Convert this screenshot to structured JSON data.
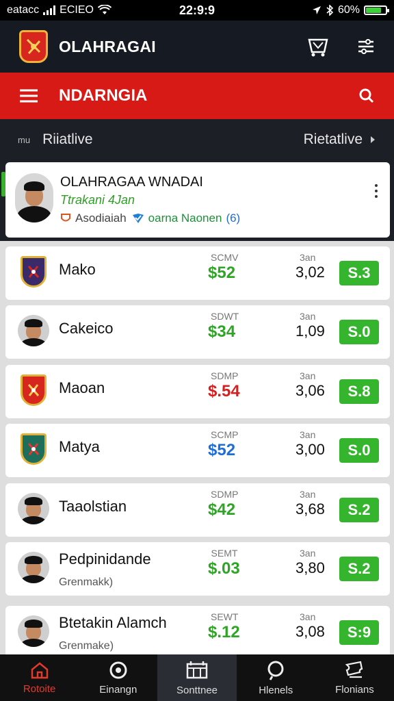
{
  "status_bar": {
    "carrier": "eatacc",
    "network": "ECIEO",
    "time": "22:9:9",
    "battery_pct": "60%",
    "battery_level": 0.8
  },
  "header": {
    "title": "OLAHRAGAI",
    "cart_icon": "basket-icon",
    "filter_icon": "sliders-icon"
  },
  "section_bar": {
    "title": "NDARNGIA",
    "menu_icon": "hamburger-icon",
    "search_icon": "search-icon"
  },
  "filter_row": {
    "left_label": "Riiatlive",
    "left_prefix": "mu",
    "right_label": "Rietatlive"
  },
  "featured": {
    "name": "OLAHRAGAA WNADAI",
    "subtitle": "Ttrakani 4Jan",
    "tag1": "Asodiaiah",
    "tag2": "oarna Naonen",
    "tag2_suffix": "(6)"
  },
  "rows": [
    {
      "name": "Mako",
      "sub": "",
      "label": "SCMV",
      "price": "$52",
      "price_color": "#2fa427",
      "cap": "3an",
      "num": "3,02",
      "score": "S.3",
      "thumb": "crest"
    },
    {
      "name": "Cakeico",
      "sub": "",
      "label": "SDWT",
      "price": "$34",
      "price_color": "#2fa427",
      "cap": "3an",
      "num": "1,09",
      "score": "S.0",
      "thumb": "player"
    },
    {
      "name": "Maoan",
      "sub": "",
      "label": "SDMP",
      "price": "$.54",
      "price_color": "#d71f1f",
      "cap": "3an",
      "num": "3,06",
      "score": "S.8",
      "thumb": "crest-red"
    },
    {
      "name": "Matya",
      "sub": "",
      "label": "SCMP",
      "price": "$52",
      "price_color": "#1e6ed8",
      "cap": "3an",
      "num": "3,00",
      "score": "S.0",
      "thumb": "crest-green"
    },
    {
      "name": "Taaolstian",
      "sub": "",
      "label": "SDMP",
      "price": "$42",
      "price_color": "#2fa427",
      "cap": "3an",
      "num": "3,68",
      "score": "S.2",
      "thumb": "player"
    },
    {
      "name": "Pedpinidande",
      "sub": "Grenmakk)",
      "label": "SEMT",
      "price": "$.03",
      "price_color": "#2fa427",
      "cap": "3an",
      "num": "3,80",
      "score": "S.2",
      "thumb": "player"
    },
    {
      "name": "Btetakin Alamch",
      "sub": "Grenmake)",
      "label": "SEWT",
      "price": "$.12",
      "price_color": "#2fa427",
      "cap": "3an",
      "num": "3,08",
      "score": "S:9",
      "thumb": "player"
    }
  ],
  "bottom_nav": [
    {
      "label": "Rotoite",
      "icon": "home-icon"
    },
    {
      "label": "Einangn",
      "icon": "target-icon"
    },
    {
      "label": "Sonttnee",
      "icon": "stats-icon"
    },
    {
      "label": "Hlenels",
      "icon": "search-icon"
    },
    {
      "label": "Flonians",
      "icon": "ticket-icon"
    }
  ],
  "colors": {
    "brand_red": "#d81a17",
    "score_green": "#35b52d",
    "active_nav": "#e23a2f"
  }
}
